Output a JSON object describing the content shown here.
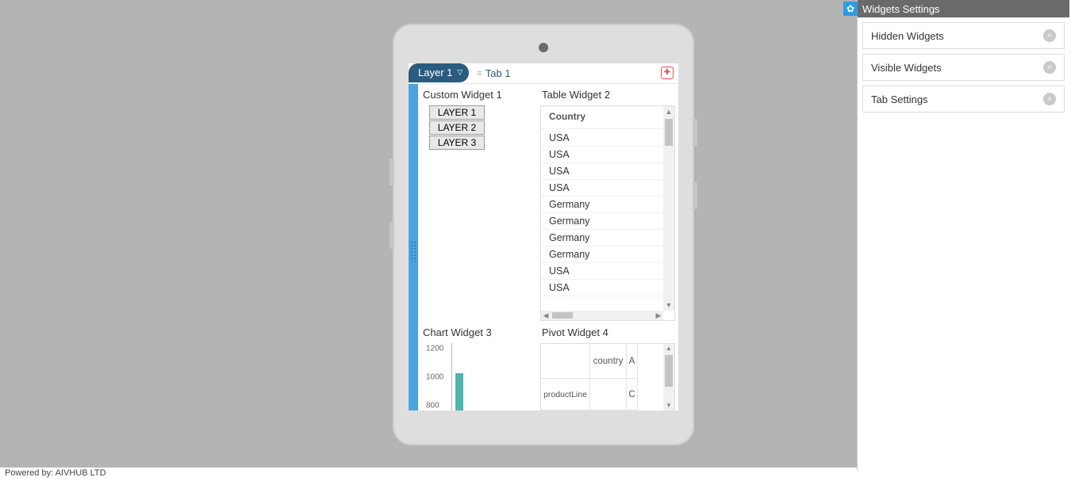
{
  "layer_chip_label": "Layer 1",
  "tab_label": "Tab 1",
  "sidebar": {
    "title": "Widgets Settings",
    "sections": [
      {
        "label": "Hidden Widgets"
      },
      {
        "label": "Visible Widgets"
      },
      {
        "label": "Tab Settings"
      }
    ]
  },
  "custom_widget": {
    "title": "Custom Widget 1",
    "buttons": [
      "LAYER 1",
      "LAYER 2",
      "LAYER 3"
    ]
  },
  "table_widget": {
    "title": "Table Widget 2",
    "header": "Country",
    "rows": [
      "USA",
      "USA",
      "USA",
      "USA",
      "Germany",
      "Germany",
      "Germany",
      "Germany",
      "USA",
      "USA"
    ]
  },
  "chart_widget": {
    "title": "Chart Widget 3"
  },
  "pivot_widget": {
    "title": "Pivot Widget 4",
    "col_header": "country",
    "col_val_partial_1": "A",
    "row_header": "productLine",
    "col_val_partial_2": "C"
  },
  "chart_data": {
    "type": "bar",
    "y_ticks": [
      1200,
      1000,
      800
    ],
    "ylim": [
      800,
      1200
    ],
    "visible_bars": [
      {
        "x_index": 0,
        "value": 1050
      }
    ],
    "xlabel": "",
    "ylabel": "",
    "title": ""
  },
  "footer": "Powered by: AIVHUB LTD"
}
